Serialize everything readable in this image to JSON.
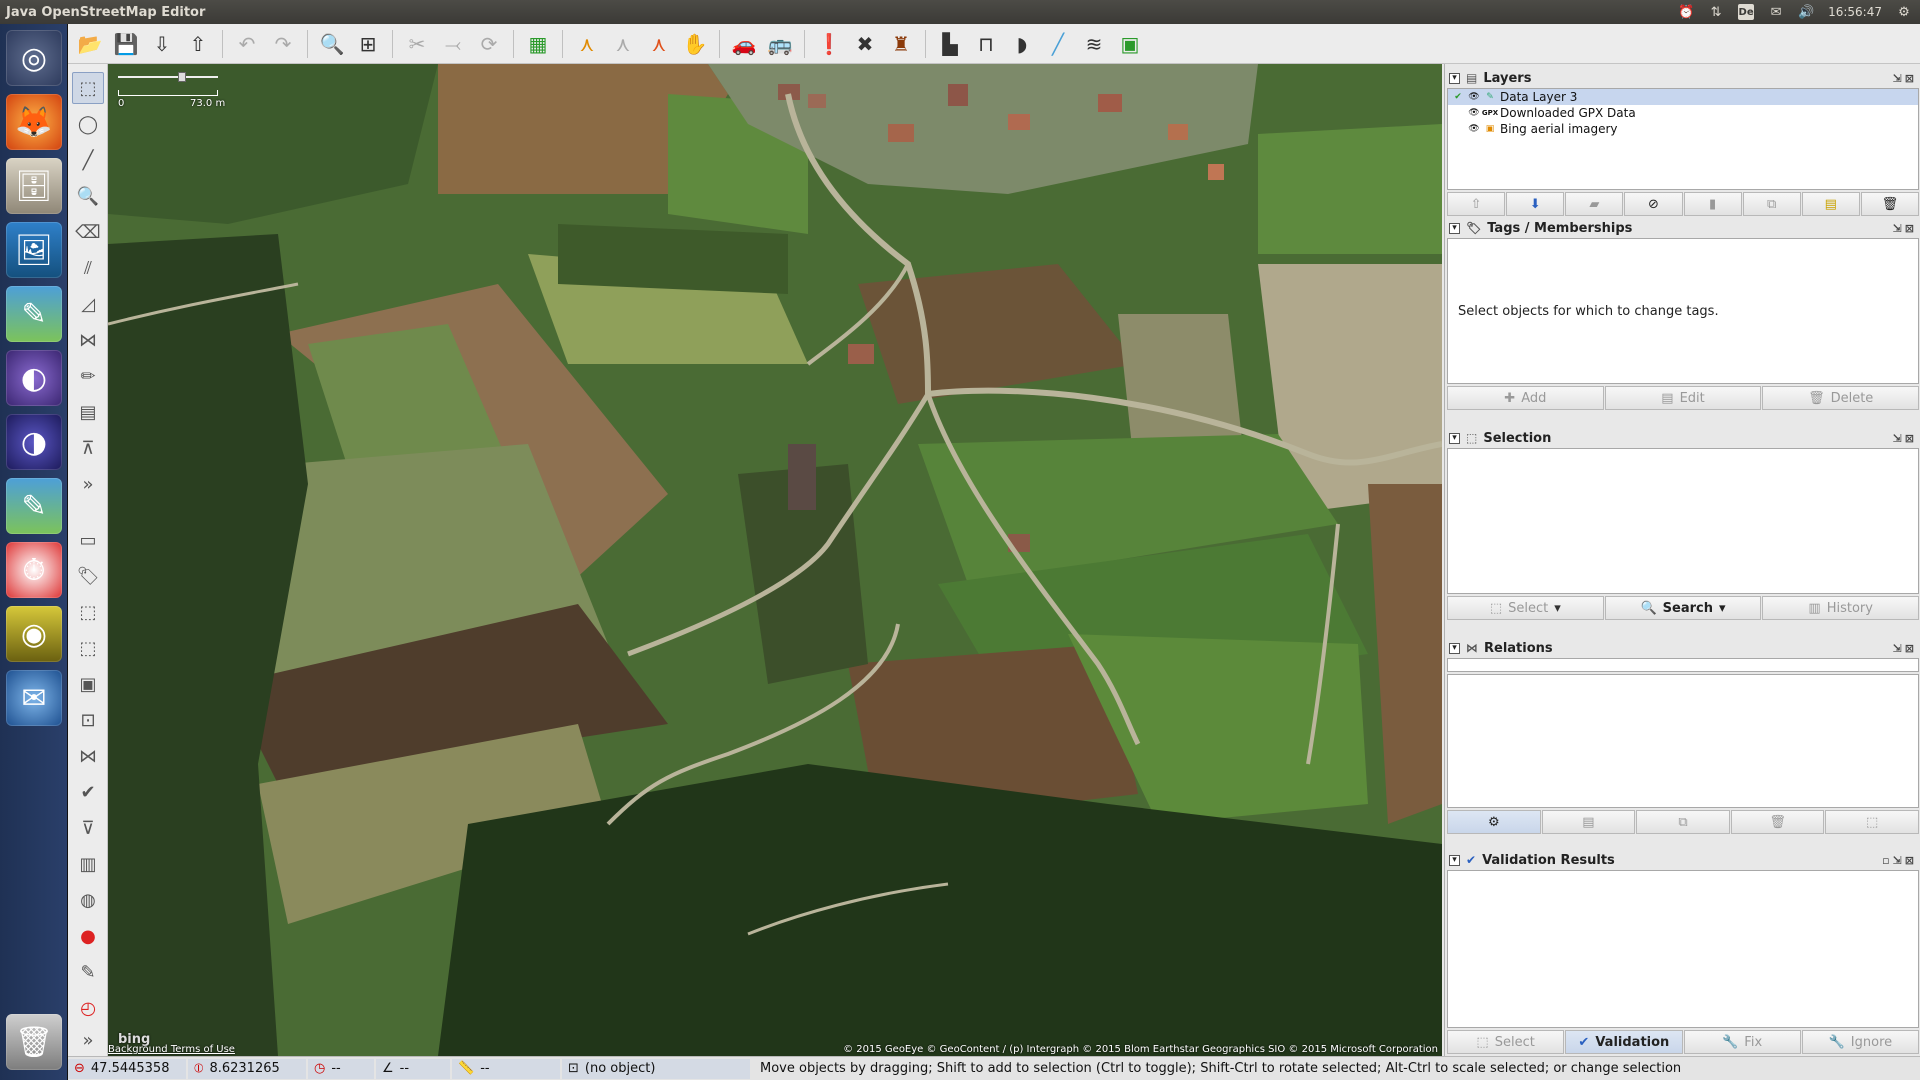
{
  "window": {
    "title": "Java OpenStreetMap Editor"
  },
  "system_tray": {
    "keyboard_layout": "De",
    "clock": "16:56:47"
  },
  "launcher": {
    "items": [
      {
        "name": "ubuntu-dash-icon"
      },
      {
        "name": "firefox-icon"
      },
      {
        "name": "file-manager-icon"
      },
      {
        "name": "image-viewer-icon"
      },
      {
        "name": "josm-launcher-icon"
      },
      {
        "name": "eclipse-icon"
      },
      {
        "name": "eclipse-alt-icon"
      },
      {
        "name": "josm-active-icon"
      },
      {
        "name": "alarm-clock-icon"
      },
      {
        "name": "speaker-icon"
      },
      {
        "name": "thunderbird-icon"
      },
      {
        "name": "trash-icon"
      }
    ]
  },
  "map": {
    "scale_zero": "0",
    "scale_length": "73.0 m",
    "imagery_attribution": "Background Terms of Use",
    "imagery_brand": "bing",
    "copyright": "© 2015 GeoEye © GeoContent / (p) Intergraph © 2015 Blom Earthstar Geographics  SIO © 2015 Microsoft Corporation"
  },
  "layers_dialog": {
    "title": "Layers",
    "layers": [
      {
        "label": "Data Layer 3",
        "icon": "data-layer-icon",
        "selected": true
      },
      {
        "label": "Downloaded GPX Data",
        "icon": "gpx-icon",
        "selected": false
      },
      {
        "label": "Bing aerial imagery",
        "icon": "imagery-icon",
        "selected": false
      }
    ]
  },
  "tags_dialog": {
    "title": "Tags / Memberships",
    "empty_message": "Select objects for which to change tags.",
    "buttons": {
      "add": "Add",
      "edit": "Edit",
      "delete": "Delete"
    }
  },
  "selection_dialog": {
    "title": "Selection",
    "buttons": {
      "select": "Select",
      "search": "Search",
      "history": "History"
    }
  },
  "relations_dialog": {
    "title": "Relations"
  },
  "validation_dialog": {
    "title": "Validation Results",
    "buttons": {
      "select": "Select",
      "validation": "Validation",
      "fix": "Fix",
      "ignore": "Ignore"
    }
  },
  "statusbar": {
    "lat": "47.5445358",
    "lon": "8.6231265",
    "heading": "--",
    "angle": "--",
    "distance": "--",
    "object": "(no object)",
    "help": "Move objects by dragging; Shift to add to selection (Ctrl to toggle); Shift-Ctrl to rotate selected; Alt-Ctrl to scale selected; or change selection"
  }
}
